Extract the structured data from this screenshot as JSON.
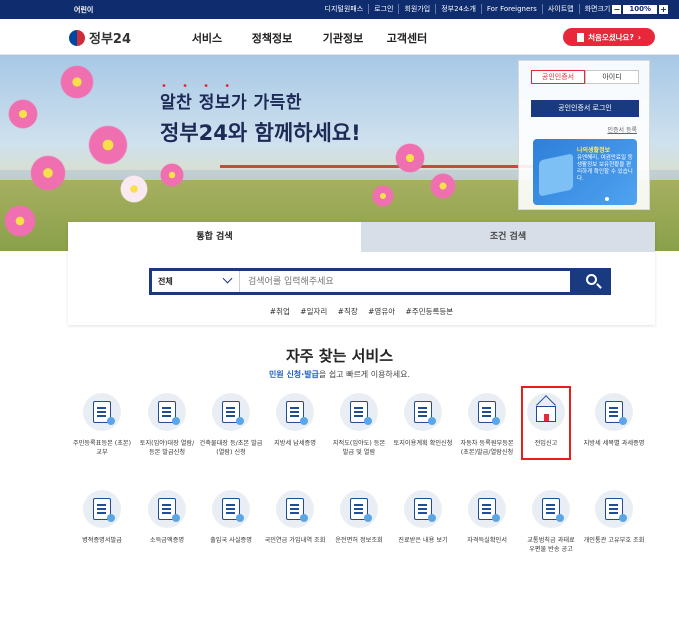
{
  "topbar": {
    "left_link": "어린이",
    "util_links": [
      "디지털원패스",
      "로그인",
      "회원가입",
      "정부24소개",
      "For Foreigners",
      "사이트맵"
    ],
    "font_size_label": "화면크기",
    "font_size_value": "100%",
    "minus": "−",
    "plus": "+"
  },
  "header": {
    "logo_text": "정부24",
    "menu": [
      "서비스",
      "정책정보",
      "기관정보",
      "고객센터"
    ],
    "start_button": "처음오셨나요?"
  },
  "hero": {
    "dots": "• • • •",
    "line1": "알찬 정보가 가득한",
    "line2": "정부24와 함께하세요!"
  },
  "login": {
    "tab_cert": "공인인증서",
    "tab_id": "아이디",
    "login_button": "공인인증서 로그인",
    "register_link": "인증서 등록",
    "banner_title": "나의생활정보",
    "banner_text": "유엔해리, 여권만료일 등 생활정보 보유현황을 편리하게 확인할 수 있습니다."
  },
  "search": {
    "tab_integrated": "통합 검색",
    "tab_condition": "조건 검색",
    "select_value": "전체",
    "placeholder": "검색어를 입력해주세요",
    "tags": [
      "#취업",
      "#일자리",
      "#직장",
      "#영유아",
      "#주민등록등본"
    ]
  },
  "frequent": {
    "title": "자주 찾는 서비스",
    "sub_highlight": "민원 신청·발급",
    "sub_rest": "을 쉽고 빠르게 이용하세요.",
    "row1": [
      {
        "label": "주민등록표등본 (초본)교부",
        "icon": "id-card-icon"
      },
      {
        "label": "토지(임야)대장 열람/등본 발급신청",
        "icon": "land-register-icon"
      },
      {
        "label": "건축물대장 등/초본 발급(열람) 신청",
        "icon": "building-register-icon"
      },
      {
        "label": "지방세 납세증명",
        "icon": "tax-certificate-icon"
      },
      {
        "label": "지적도(임야도) 등본 발급 및 열람",
        "icon": "cadastral-map-icon"
      },
      {
        "label": "토지이용계획 확인신청",
        "icon": "land-plan-icon"
      },
      {
        "label": "자동차 등록원부등본 (초본)발급/열람신청",
        "icon": "car-register-icon"
      },
      {
        "label": "전입신고",
        "icon": "home-icon"
      },
      {
        "label": "지방세 세목별 과세증명",
        "icon": "local-tax-icon"
      }
    ],
    "row2": [
      {
        "label": "병적증명서발급",
        "icon": "military-record-icon"
      },
      {
        "label": "소득금액증명",
        "icon": "income-icon"
      },
      {
        "label": "출입국 사실증명",
        "icon": "passport-icon"
      },
      {
        "label": "국민연금 가입내역 조회",
        "icon": "pension-icon"
      },
      {
        "label": "운전면허 정보조회",
        "icon": "driver-license-icon"
      },
      {
        "label": "진료받은 내용 보기",
        "icon": "medical-icon"
      },
      {
        "label": "자격득실확인서",
        "icon": "qualification-icon"
      },
      {
        "label": "교통범칙금 과태료 우편물 반송 공고",
        "icon": "traffic-fine-icon"
      },
      {
        "label": "개인통관 고유부호 조회",
        "icon": "customs-icon"
      }
    ]
  }
}
